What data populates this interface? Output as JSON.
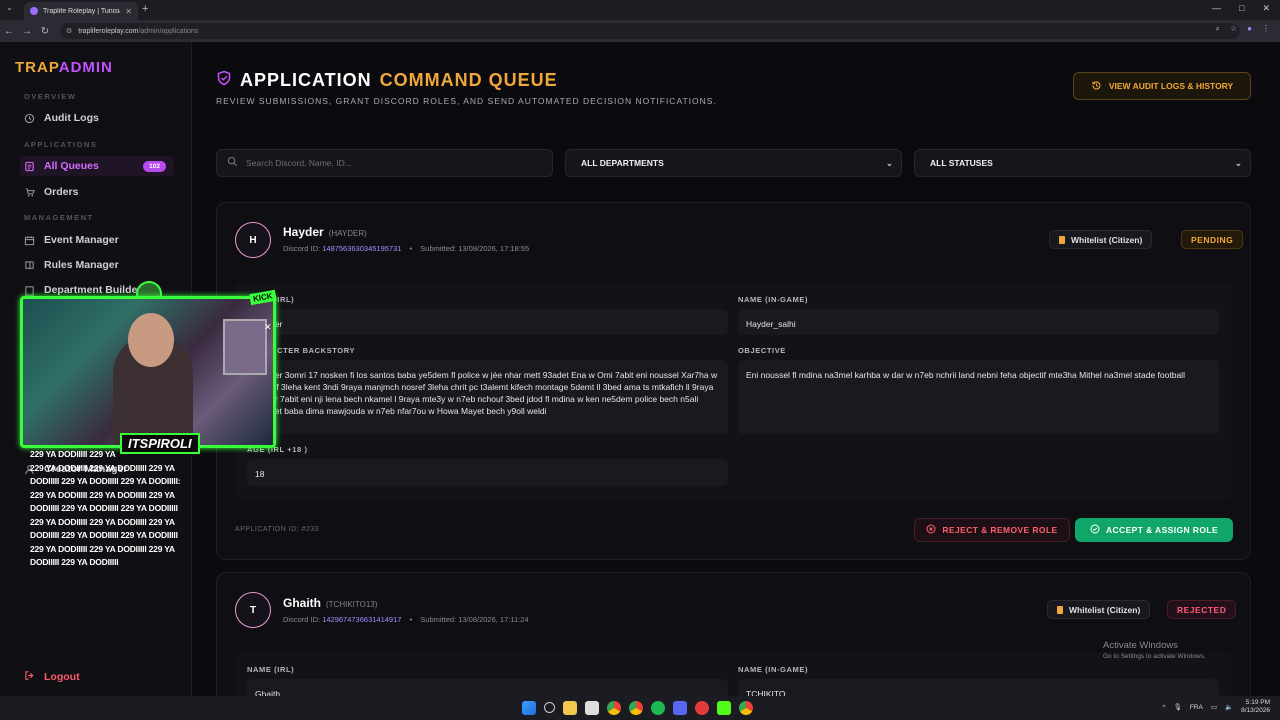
{
  "browser": {
    "tab_title": "Traplife Roleplay | Tunisian GTA",
    "url_host": "trapliferoleplay.com",
    "url_path": "/admin/applications"
  },
  "sidebar": {
    "brand_part1": "TRAP",
    "brand_part2": "ADMIN",
    "sections": {
      "overview": "OVERVIEW",
      "applications": "APPLICATIONS",
      "management": "MANAGEMENT"
    },
    "items": [
      {
        "label": "Audit Logs",
        "icon": "audit-icon"
      },
      {
        "label": "All Queues",
        "icon": "queue-icon",
        "badge": "102",
        "active": true
      },
      {
        "label": "Orders",
        "icon": "orders-icon"
      },
      {
        "label": "Event Manager",
        "icon": "calendar-icon"
      },
      {
        "label": "Rules Manager",
        "icon": "book-icon"
      },
      {
        "label": "Department Builder",
        "icon": "building-icon"
      },
      {
        "label": "Creator Manager",
        "icon": "creator-icon"
      }
    ],
    "logout": "Logout"
  },
  "header": {
    "title_part1": "APPLICATION",
    "title_part2": "COMMAND QUEUE",
    "subtitle": "REVIEW SUBMISSIONS, GRANT DISCORD ROLES, AND SEND AUTOMATED DECISION NOTIFICATIONS.",
    "audit_button": "VIEW AUDIT LOGS & HISTORY"
  },
  "filters": {
    "search_placeholder": "Search Discord, Name, ID...",
    "department": "ALL DEPARTMENTS",
    "status": "ALL STATUSES"
  },
  "applications": [
    {
      "initial": "H",
      "name": "Hayder",
      "handle": "(HAYDER)",
      "discord_label": "Discord ID:",
      "discord_id": "1487563630345195731",
      "submitted": "Submitted: 13/08/2026, 17:18:55",
      "type": "Whitelist (Citizen)",
      "status": "PENDING",
      "fields": {
        "name_irl_label": "NAME (IRL)",
        "name_irl": "Hayder",
        "name_game_label": "NAME (IN-GAME)",
        "name_game": "Hayder_salhi",
        "backstory_label": "CHARACTER BACKSTORY",
        "backstory": "Hayder 3omri 17 nosken fi los santos baba ye5dem fl police w jée nhar mett 93adet Ena w Omi 7abit eni noussel Xar7ha w nosref 3leha kent 3ndi 9raya manjmch nosref 3leha chrit pc t3alemt kifech montage 5demt ll 3bed ama ts mtkafich ll 9raya wl dar 7abit eni nji lena bech nkamel l 9raya mte3y w n7eb nchouf 3bed jdod fl mdina w ken ne5dem police bech n5ali blasset baba dima mawjouda w n7eb nfar7ou w Howa Mayet bech y9oll weldi",
        "objective_label": "OBJECTIVE",
        "objective": "Eni noussel fl mdina na3mel karhba w dar w n7eb nchrii land nebni feha objectif mte3ha Mithel na3mel stade football",
        "age_label": "AGE (IRL +18 )",
        "age": "18"
      },
      "app_id": "APPLICATION ID: #233",
      "reject_label": "REJECT & REMOVE ROLE",
      "accept_label": "ACCEPT & ASSIGN ROLE"
    },
    {
      "initial": "T",
      "name": "Ghaith",
      "handle": "(TCHIKITO13)",
      "discord_label": "Discord ID:",
      "discord_id": "1429674736631414917",
      "submitted": "Submitted: 13/08/2026, 17:11:24",
      "type": "Whitelist (Citizen)",
      "status": "REJECTED",
      "fields": {
        "name_irl_label": "NAME (IRL)",
        "name_irl": "Ghaith",
        "name_game_label": "NAME (IN-GAME)",
        "name_game": "TCHIKITO"
      }
    }
  ],
  "overlay": {
    "streamer": "ITSPIROLI",
    "kick": "KICK",
    "chat": "229 YA DODIIIII 229 YA\n229 YA DODIIIII 229 YA DODIIIII 229 YA\nDODIIIII 229 YA DODIIIII 229 YA DODIIIII:\n229 YA DODIIIII 229 YA DODIIIII 229 YA\nDODIIIII 229 YA DODIIIII 229 YA DODIIIII\n229 YA DODIIIII 229 YA DODIIIII 229 YA\nDODIIIII 229 YA DODIIIII 229 YA DODIIIII\n229 YA DODIIIII 229 YA DODIIIII 229 YA\nDODIIIII 229 YA DODIIIII"
  },
  "windows": {
    "activate_title": "Activate Windows",
    "activate_sub": "Go to Settings to activate Windows.",
    "lang": "FRA",
    "time": "5:19 PM",
    "date": "8/13/2026"
  },
  "colors": {
    "accent_orange": "#f0a83a",
    "accent_purple": "#c550ff",
    "accept_green": "#10a66a",
    "reject_red": "#ff5f6f"
  }
}
